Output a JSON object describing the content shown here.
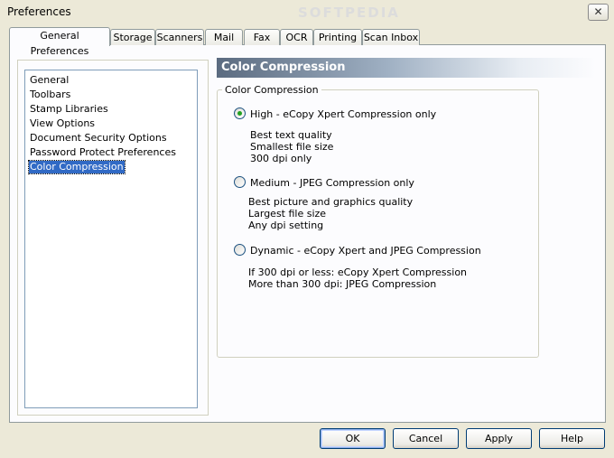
{
  "window": {
    "title": "Preferences",
    "watermark": "SOFTPEDIA",
    "close_glyph": "✕"
  },
  "tabs": [
    {
      "label": "General Preferences",
      "active": true
    },
    {
      "label": "Storage"
    },
    {
      "label": "Scanners"
    },
    {
      "label": "Mail"
    },
    {
      "label": "Fax"
    },
    {
      "label": "OCR"
    },
    {
      "label": "Printing"
    },
    {
      "label": "Scan Inbox"
    }
  ],
  "sidebar": {
    "items": [
      {
        "label": "General"
      },
      {
        "label": "Toolbars"
      },
      {
        "label": "Stamp Libraries"
      },
      {
        "label": "View Options"
      },
      {
        "label": "Document Security Options"
      },
      {
        "label": "Password Protect Preferences"
      },
      {
        "label": "Color Compression",
        "selected": true
      }
    ]
  },
  "panel": {
    "header": "Color Compression",
    "group_label": "Color Compression",
    "options": [
      {
        "label": "High - eCopy Xpert Compression only",
        "checked": true,
        "details": [
          "Best text quality",
          "Smallest file size",
          "300 dpi only"
        ]
      },
      {
        "label": "Medium - JPEG Compression only",
        "checked": false,
        "details": [
          "Best picture and graphics quality",
          "Largest file size",
          "Any dpi setting"
        ]
      },
      {
        "label": "Dynamic - eCopy Xpert and JPEG Compression",
        "checked": false,
        "details": [
          "If 300 dpi or less: eCopy Xpert Compression",
          "More than 300 dpi: JPEG Compression"
        ]
      }
    ]
  },
  "buttons": {
    "ok": "OK",
    "cancel": "Cancel",
    "apply": "Apply",
    "help": "Help"
  },
  "colors": {
    "selection": "#316ac5",
    "header_start": "#5b6b80",
    "dialog_bg": "#ece9d8"
  }
}
